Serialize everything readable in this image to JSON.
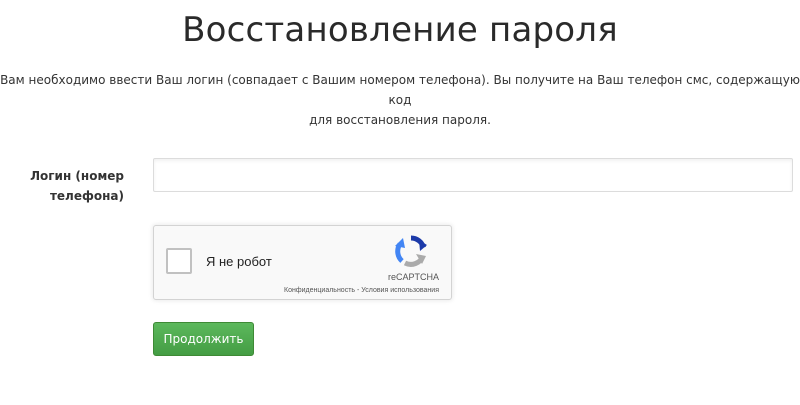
{
  "page": {
    "title": "Восстановление пароля",
    "description_line1": "Вам необходимо ввести Ваш логин (совпадает с Вашим номером телефона). Вы получите на Ваш телефон смс, содержащую код",
    "description_line2": "для восстановления пароля."
  },
  "form": {
    "login_label_line1": "Логин (номер",
    "login_label_line2": "телефона)",
    "login_value": "",
    "login_placeholder": "",
    "submit_label": "Продолжить"
  },
  "recaptcha": {
    "label": "Я не робот",
    "brand": "reCAPTCHA",
    "privacy_link": "Конфиденциальность",
    "separator": " - ",
    "terms_link": "Условия использования",
    "logo_icon": "recaptcha-logo-icon"
  },
  "colors": {
    "button_green": "#5cb85c",
    "recaptcha_blue": "#1c3aa9",
    "recaptcha_light_blue": "#4285f4",
    "recaptcha_grey": "#ababab"
  }
}
